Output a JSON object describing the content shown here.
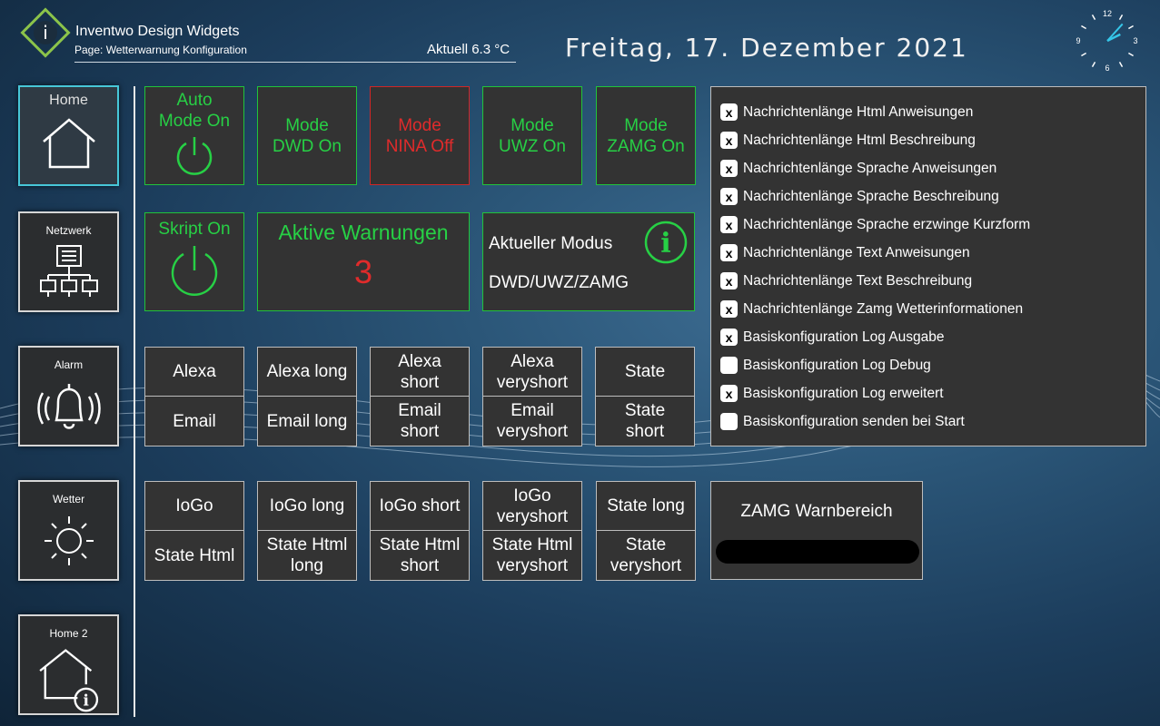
{
  "header": {
    "app_title": "Inventwo Design Widgets",
    "page_subtitle": "Page: Wetterwarnung Konfiguration",
    "temperature": "Aktuell 6.3 °C",
    "date": "Freitag, 17. Dezember 2021",
    "clock": {
      "hour": 2,
      "minute": 7,
      "labels": [
        "12",
        "3",
        "6",
        "9"
      ]
    }
  },
  "sidebar": {
    "items": [
      {
        "label": "Home",
        "icon": "home-icon"
      },
      {
        "label": "Netzwerk",
        "icon": "network-icon"
      },
      {
        "label": "Alarm",
        "icon": "bell-icon"
      },
      {
        "label": "Wetter",
        "icon": "sun-icon"
      },
      {
        "label": "Home 2",
        "icon": "home-info-icon"
      }
    ]
  },
  "modes": {
    "auto": "Auto\nMode On",
    "dwd": "Mode\nDWD On",
    "nina": "Mode\nNINA Off",
    "uwz": "Mode\nUWZ On",
    "zamg": "Mode\nZAMG On",
    "skript": "Skript On"
  },
  "warnings": {
    "title": "Aktive Warnungen",
    "count": "3"
  },
  "current_mode": {
    "title": "Aktueller Modus",
    "value": "DWD/UWZ/ZAMG",
    "icon": "info-icon"
  },
  "grid1": [
    [
      "Alexa",
      "Email"
    ],
    [
      "Alexa long",
      "Email long"
    ],
    [
      "Alexa\nshort",
      "Email\nshort"
    ],
    [
      "Alexa\nveryshort",
      "Email\nveryshort"
    ],
    [
      "State",
      "State\nshort"
    ]
  ],
  "grid2": [
    [
      "IoGo",
      "State Html"
    ],
    [
      "IoGo long",
      "State Html\nlong"
    ],
    [
      "IoGo short",
      "State Html\nshort"
    ],
    [
      "IoGo\nveryshort",
      "State Html\nveryshort"
    ],
    [
      "State long",
      "State\nveryshort"
    ]
  ],
  "checkboxes": [
    {
      "label": "Nachrichtenlänge Html Anweisungen",
      "checked": true,
      "mark": "x"
    },
    {
      "label": "Nachrichtenlänge Html Beschreibung",
      "checked": true,
      "mark": "x"
    },
    {
      "label": "Nachrichtenlänge Sprache Anweisungen",
      "checked": true,
      "mark": "x"
    },
    {
      "label": "Nachrichtenlänge Sprache Beschreibung",
      "checked": true,
      "mark": "x"
    },
    {
      "label": "Nachrichtenlänge Sprache erzwinge Kurzform",
      "checked": true,
      "mark": "x"
    },
    {
      "label": "Nachrichtenlänge Text Anweisungen",
      "checked": true,
      "mark": "x"
    },
    {
      "label": "Nachrichtenlänge Text Beschreibung",
      "checked": true,
      "mark": "x"
    },
    {
      "label": "Nachrichtenlänge Zamg Wetterinformationen",
      "checked": true,
      "mark": "x"
    },
    {
      "label": "Basiskonfiguration Log Ausgabe",
      "checked": true,
      "mark": "x"
    },
    {
      "label": "Basiskonfiguration Log Debug",
      "checked": false,
      "mark": ""
    },
    {
      "label": "Basiskonfiguration Log erweitert",
      "checked": true,
      "mark": "x"
    },
    {
      "label": "Basiskonfiguration senden bei Start",
      "checked": false,
      "mark": ""
    }
  ],
  "zamg_area": {
    "title": "ZAMG Warnbereich"
  },
  "colors": {
    "on": "#27d045",
    "off": "#e02b2b",
    "active_nav": "#47c7d8",
    "logo": "#8bc34a"
  }
}
